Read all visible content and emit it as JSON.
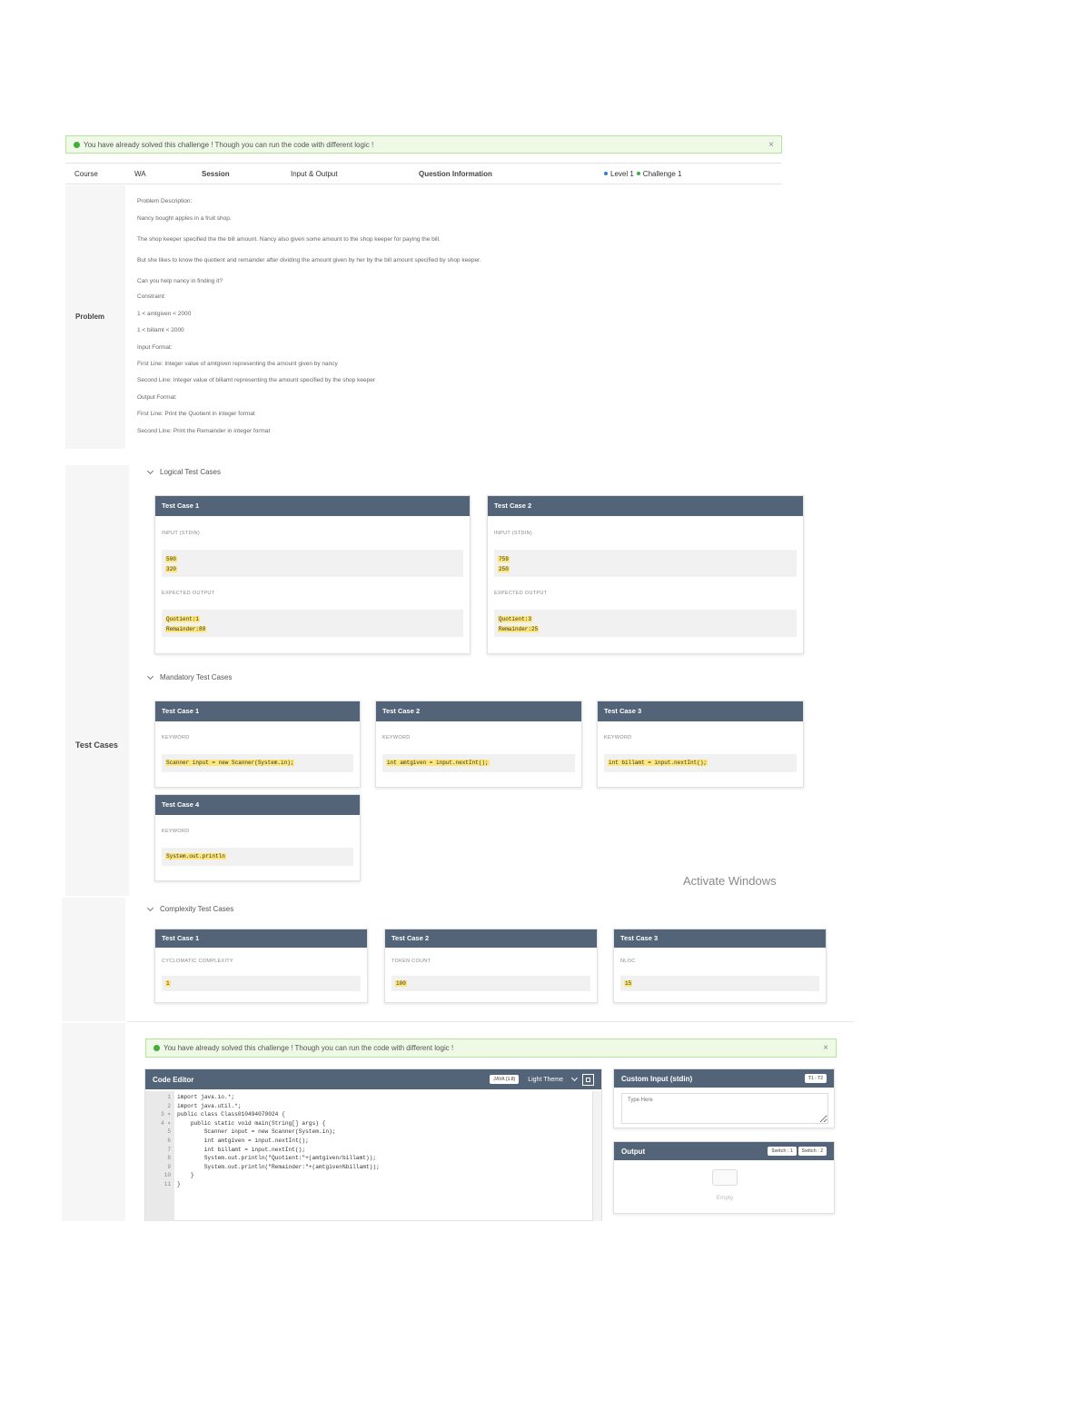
{
  "banner": {
    "message": "You have already solved this challenge ! Though you can run the code with different logic !",
    "close": "×"
  },
  "header": {
    "course_label": "Course",
    "course_value": "WA",
    "session_label": "Session",
    "session_value": "Input & Output",
    "question_info_label": "Question Information",
    "level": "Level 1",
    "challenge": "Challenge 1"
  },
  "problem": {
    "label": "Problem",
    "lines": [
      "Problem Description:",
      "Nancy bought apples in a fruit shop.",
      "The shop keeper specified the the bill amount. Nancy also given some amount to the shop keeper for paying the bill.",
      "But she likes to know the quotient and remainder after dividing the amount given by her by the bill amount specified by shop keeper.",
      "Can you help nancy in finding it?",
      "Constraint:",
      "1 < amtgiven < 2000",
      "1 < billamt < 2000",
      "Input Format:",
      "First Line: Integer value of amtgiven representing the amount given by nancy",
      "Second Line: Integer value of billamt representing the amount specified by the shop keeper",
      "Output Format:",
      "First Line: Print the Quotient in integer format",
      "Second Line: Print the Remainder in integer format"
    ]
  },
  "test_cases": {
    "label": "Test Cases",
    "logical": {
      "title": "Logical Test Cases",
      "cases": [
        {
          "title": "Test Case 1",
          "input_label": "INPUT (STDIN)",
          "input": [
            "500",
            "320"
          ],
          "output_label": "EXPECTED OUTPUT",
          "output": [
            "Quotient:1",
            "Remainder:80"
          ]
        },
        {
          "title": "Test Case 2",
          "input_label": "INPUT (STDIN)",
          "input": [
            "759",
            "250"
          ],
          "output_label": "EXPECTED OUTPUT",
          "output": [
            "Quotient:3",
            "Remainder:25"
          ]
        }
      ]
    },
    "mandatory": {
      "title": "Mandatory Test Cases",
      "cases": [
        {
          "title": "Test Case 1",
          "label": "KEYWORD",
          "value": "Scanner input = new Scanner(System.in);"
        },
        {
          "title": "Test Case 2",
          "label": "KEYWORD",
          "value": "int amtgiven = input.nextInt();"
        },
        {
          "title": "Test Case 3",
          "label": "KEYWORD",
          "value": "int billamt = input.nextInt();"
        },
        {
          "title": "Test Case 4",
          "label": "KEYWORD",
          "value": "System.out.println"
        }
      ]
    },
    "complexity": {
      "title": "Complexity Test Cases",
      "cases": [
        {
          "title": "Test Case 1",
          "label": "CYCLOMATIC COMPLEXITY",
          "value": "1"
        },
        {
          "title": "Test Case 2",
          "label": "TOKEN COUNT",
          "value": "100"
        },
        {
          "title": "Test Case 3",
          "label": "NLOC",
          "value": "15"
        }
      ]
    }
  },
  "watermark": "Activate Windows",
  "editor": {
    "title": "Code Editor",
    "language": "JAVA (1.8)",
    "theme": "Light Theme",
    "lines": [
      "import java.io.*;",
      "import java.util.*;",
      "public class Class010494070024 {",
      "    public static void main(String[] args) {",
      "        Scanner input = new Scanner(System.in);",
      "        int amtgiven = input.nextInt();",
      "        int billamt = input.nextInt();",
      "        System.out.println(\"Quotient:\"+(amtgiven/billamt));",
      "        System.out.println(\"Remainder:\"+(amtgiven%billamt));",
      "    }",
      "}"
    ]
  },
  "custom_input": {
    "title": "Custom Input (stdin)",
    "button": "T1 - T2",
    "placeholder": "Type Here"
  },
  "output": {
    "title": "Output",
    "btn1": "Switch : 1",
    "btn2": "Switch : 2",
    "empty": "Empty"
  }
}
